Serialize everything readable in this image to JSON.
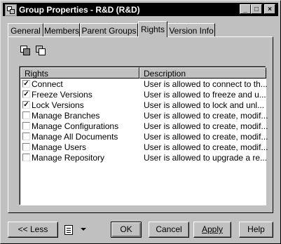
{
  "window": {
    "title": "Group Properties - R&D (R&D)"
  },
  "titlebar_buttons": [
    {
      "label": "_"
    },
    {
      "label": "□"
    },
    {
      "label": "×"
    }
  ],
  "tabs": [
    {
      "label": "General"
    },
    {
      "label": "Members"
    },
    {
      "label": "Parent Groups"
    },
    {
      "label": "Rights"
    },
    {
      "label": "Version Info"
    }
  ],
  "active_tab": "Rights",
  "toolbar": {
    "icons": [
      "select-all-icon",
      "deselect-all-icon"
    ]
  },
  "list": {
    "columns": [
      "Rights",
      "Description"
    ],
    "rows": [
      {
        "right": "Connect",
        "description": "User is allowed to connect to th...",
        "checked": true
      },
      {
        "right": "Freeze Versions",
        "description": "User is allowed to freeze and u...",
        "checked": true
      },
      {
        "right": "Lock Versions",
        "description": "User is allowed to lock and unl...",
        "checked": true
      },
      {
        "right": "Manage Branches",
        "description": "User is allowed to create, modif...",
        "checked": false
      },
      {
        "right": "Manage Configurations",
        "description": "User is allowed to create, modif...",
        "checked": false
      },
      {
        "right": "Manage All Documents",
        "description": "User is allowed to create, modif...",
        "checked": false
      },
      {
        "right": "Manage Users",
        "description": "User is allowed to create, modif...",
        "checked": false
      },
      {
        "right": "Manage Repository",
        "description": "User is allowed to upgrade a re...",
        "checked": false
      }
    ]
  },
  "buttons": {
    "less": "<< Less",
    "ok": "OK",
    "cancel": "Cancel",
    "apply": "Apply",
    "help": "Help"
  }
}
